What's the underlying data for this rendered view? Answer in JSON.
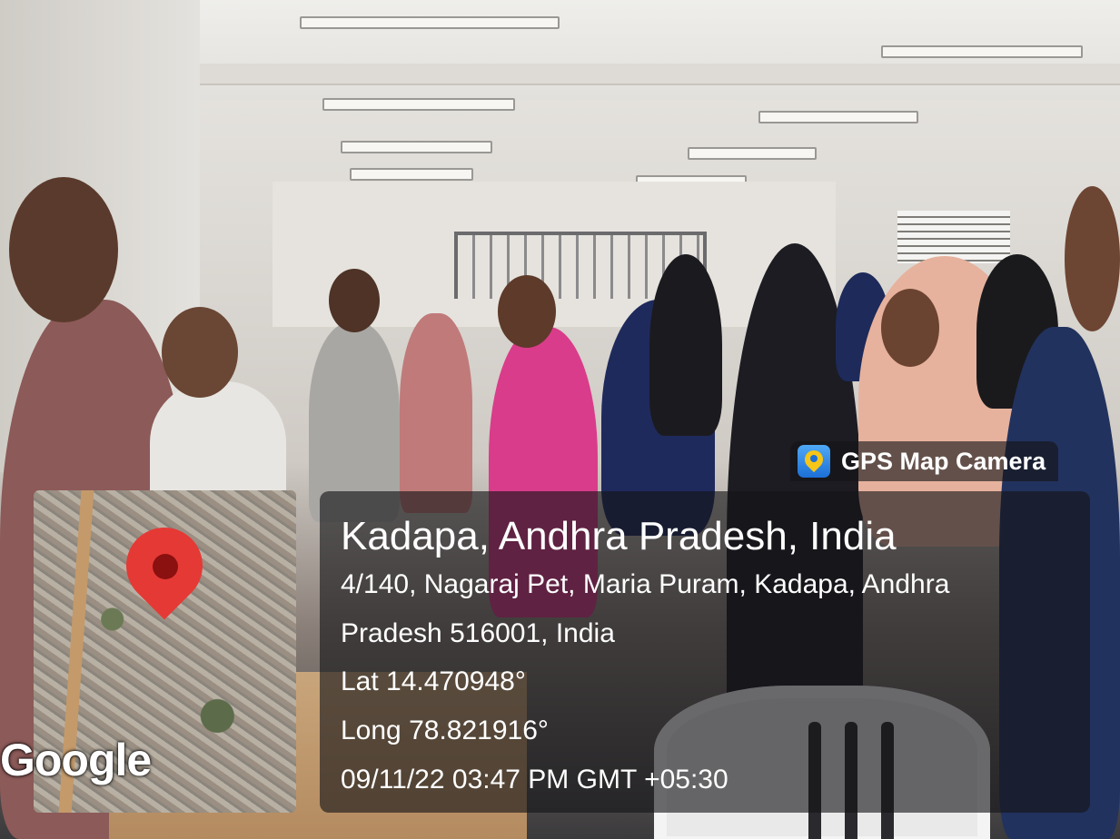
{
  "overlay": {
    "brand": "GPS Map Camera",
    "brand_icon": "gps-map-camera-icon",
    "location_title": "Kadapa, Andhra Pradesh, India",
    "address_line_1": "4/140, Nagaraj Pet, Maria Puram, Kadapa, Andhra",
    "address_line_2": "Pradesh 516001, India",
    "latitude": "Lat 14.470948°",
    "longitude": "Long 78.821916°",
    "datetime": "09/11/22 03:47 PM GMT +05:30"
  },
  "map": {
    "logo": "Google",
    "pin_icon": "map-pin-icon",
    "pin_color": "#e53935"
  }
}
